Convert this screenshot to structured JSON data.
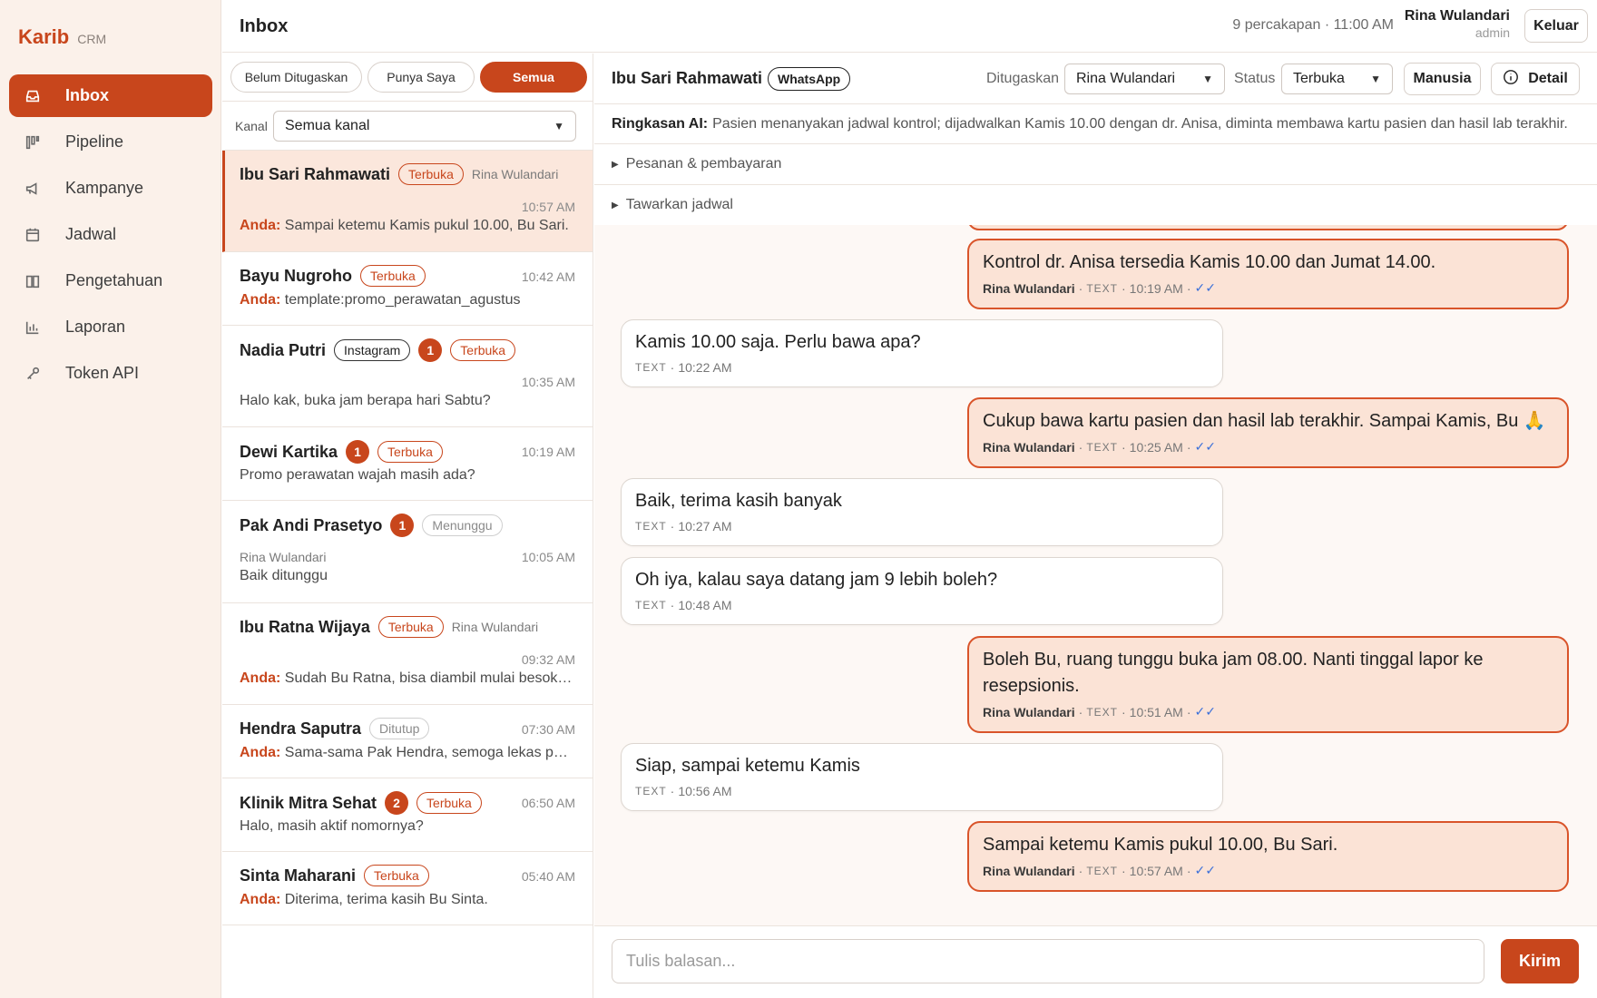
{
  "brand": {
    "name": "Karib",
    "sub": "CRM"
  },
  "nav": [
    {
      "label": "Inbox",
      "icon": "inbox-icon",
      "active": true
    },
    {
      "label": "Pipeline",
      "icon": "pipeline-icon"
    },
    {
      "label": "Kampanye",
      "icon": "megaphone-icon"
    },
    {
      "label": "Jadwal",
      "icon": "calendar-icon"
    },
    {
      "label": "Pengetahuan",
      "icon": "book-icon"
    },
    {
      "label": "Laporan",
      "icon": "chart-icon"
    },
    {
      "label": "Token API",
      "icon": "key-icon"
    }
  ],
  "header": {
    "title": "Inbox",
    "conversation_count": "9 percakapan · 11:00 AM",
    "user_name": "Rina Wulandari",
    "user_role": "admin",
    "logout_label": "Keluar"
  },
  "filters": {
    "tabs": [
      "Belum Ditugaskan",
      "Punya Saya",
      "Semua"
    ],
    "active_tab": "Semua",
    "channel_label": "Kanal",
    "channel_value": "Semua kanal"
  },
  "conversations": [
    {
      "name": "Ibu Sari Rahmawati",
      "status": "Terbuka",
      "assignee": "Rina Wulandari",
      "time": "10:57 AM",
      "prefix": "Anda:",
      "preview": "Sampai ketemu Kamis pukul 10.00, Bu Sari."
    },
    {
      "name": "Bayu Nugroho",
      "status": "Terbuka",
      "time": "10:42 AM",
      "prefix": "Anda:",
      "preview": "template:promo_perawatan_agustus"
    },
    {
      "name": "Nadia Putri",
      "channel": "Instagram",
      "unread": "1",
      "status": "Terbuka",
      "time": "10:35 AM",
      "preview": "Halo kak, buka jam berapa hari Sabtu?"
    },
    {
      "name": "Dewi Kartika",
      "unread": "1",
      "status": "Terbuka",
      "time": "10:19 AM",
      "preview": "Promo perawatan wajah masih ada?"
    },
    {
      "name": "Pak Andi Prasetyo",
      "unread": "1",
      "status": "Menunggu",
      "assignee": "Rina Wulandari",
      "time": "10:05 AM",
      "preview": "Baik ditunggu"
    },
    {
      "name": "Ibu Ratna Wijaya",
      "status": "Terbuka",
      "assignee": "Rina Wulandari",
      "time": "09:32 AM",
      "prefix": "Anda:",
      "preview": "Sudah Bu Ratna, bisa diambil mulai besok pagi."
    },
    {
      "name": "Hendra Saputra",
      "status": "Ditutup",
      "time": "07:30 AM",
      "prefix": "Anda:",
      "preview": "Sama-sama Pak Hendra, semoga lekas pulih."
    },
    {
      "name": "Klinik Mitra Sehat",
      "unread": "2",
      "status": "Terbuka",
      "time": "06:50 AM",
      "preview": "Halo, masih aktif nomornya?"
    },
    {
      "name": "Sinta Maharani",
      "status": "Terbuka",
      "time": "05:40 AM",
      "prefix": "Anda:",
      "preview": "Diterima, terima kasih Bu Sinta."
    }
  ],
  "chat": {
    "contact_name": "Ibu Sari Rahmawati",
    "channel": "WhatsApp",
    "assigned_label": "Ditugaskan",
    "assigned_value": "Rina Wulandari",
    "status_label": "Status",
    "status_value": "Terbuka",
    "human_label": "Manusia",
    "detail_label": "Detail",
    "ai_summary_label": "Ringkasan AI:",
    "ai_summary": "Pasien menanyakan jadwal kontrol; dijadwalkan Kamis 10.00 dengan dr. Anisa, diminta membawa kartu pasien dan hasil lab terakhir.",
    "sections": [
      "Pesanan & pembayaran",
      "Tawarkan jadwal"
    ],
    "messages": [
      {
        "dir": "out",
        "text": "Kontrol dr. Anisa tersedia Kamis 10.00 dan Jumat 14.00.",
        "author": "Rina Wulandari",
        "type": "TEXT",
        "time": "10:19 AM"
      },
      {
        "dir": "in",
        "text": "Kamis 10.00 saja. Perlu bawa apa?",
        "type": "TEXT",
        "time": "10:22 AM"
      },
      {
        "dir": "out",
        "text": "Cukup bawa kartu pasien dan hasil lab terakhir. Sampai Kamis, Bu 🙏",
        "author": "Rina Wulandari",
        "type": "TEXT",
        "time": "10:25 AM"
      },
      {
        "dir": "in",
        "text": "Baik, terima kasih banyak",
        "type": "TEXT",
        "time": "10:27 AM"
      },
      {
        "dir": "in",
        "text": "Oh iya, kalau saya datang jam 9 lebih boleh?",
        "type": "TEXT",
        "time": "10:48 AM"
      },
      {
        "dir": "out",
        "text": "Boleh Bu, ruang tunggu buka jam 08.00. Nanti tinggal lapor ke resepsionis.",
        "author": "Rina Wulandari",
        "type": "TEXT",
        "time": "10:51 AM"
      },
      {
        "dir": "in",
        "text": "Siap, sampai ketemu Kamis",
        "type": "TEXT",
        "time": "10:56 AM"
      },
      {
        "dir": "out",
        "text": "Sampai ketemu Kamis pukul 10.00, Bu Sari.",
        "author": "Rina Wulandari",
        "type": "TEXT",
        "time": "10:57 AM"
      }
    ],
    "reply_placeholder": "Tulis balasan...",
    "send_label": "Kirim"
  },
  "colors": {
    "accent": "#c8461c",
    "outgoing_bubble": "#fbe3d6",
    "sidebar_bg": "#fbf1ea"
  }
}
